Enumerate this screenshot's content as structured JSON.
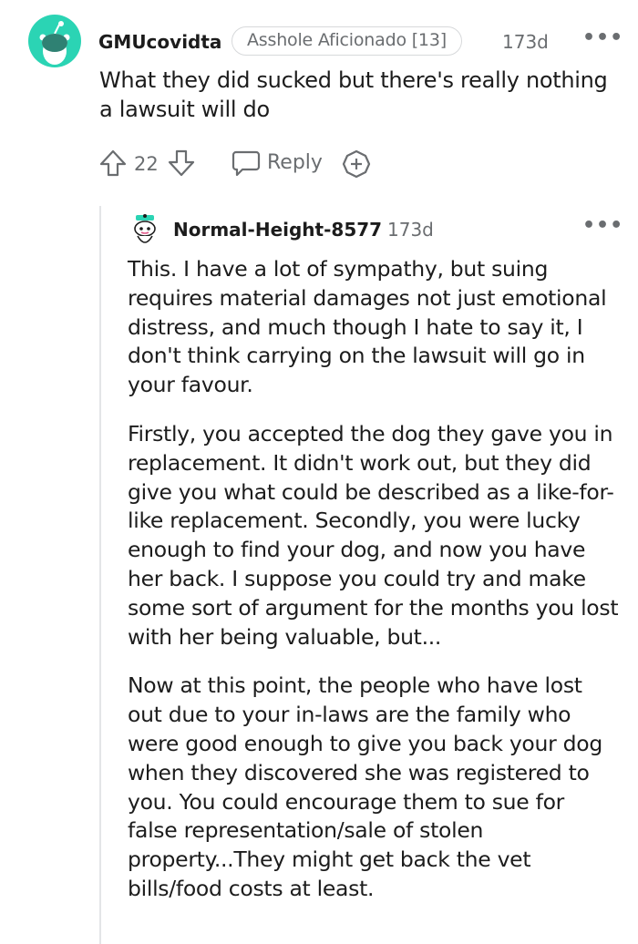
{
  "comment": {
    "username": "GMUcovidta",
    "flair": "Asshole Aficionado [13]",
    "age": "173d",
    "more_icon": "more-options-icon",
    "text": "What they did sucked but there's really nothing a lawsuit will do",
    "vote_count": "22",
    "reply_label": "Reply"
  },
  "reply": {
    "username": "Normal-Height-8577",
    "age": "173d",
    "paragraphs": [
      "This. I have a lot of sympathy, but suing requires material damages not just emotional distress, and much though I hate to say it, I don't think carrying on the lawsuit will go in your favour.",
      "Firstly, you accepted the dog they gave you in replacement. It didn't work out, but they did give you what could be described as a like-for-like replacement. Secondly, you were lucky enough to find your dog, and now you have her back. I suppose you could try and make some sort of argument for the months you lost with her being valuable, but...",
      "Now at this point, the people who have lost out due to your in-laws are the family who were good enough to give you back your dog when they discovered she was registered to you. You could encourage them to sue for false representation/sale of stolen property...They might get back the vet bills/food costs at least."
    ]
  },
  "colors": {
    "avatar_bg": "#2bd4b4",
    "text": "#1c1c1c",
    "meta": "#6a6d70",
    "thread_line": "#e3e5e7"
  }
}
